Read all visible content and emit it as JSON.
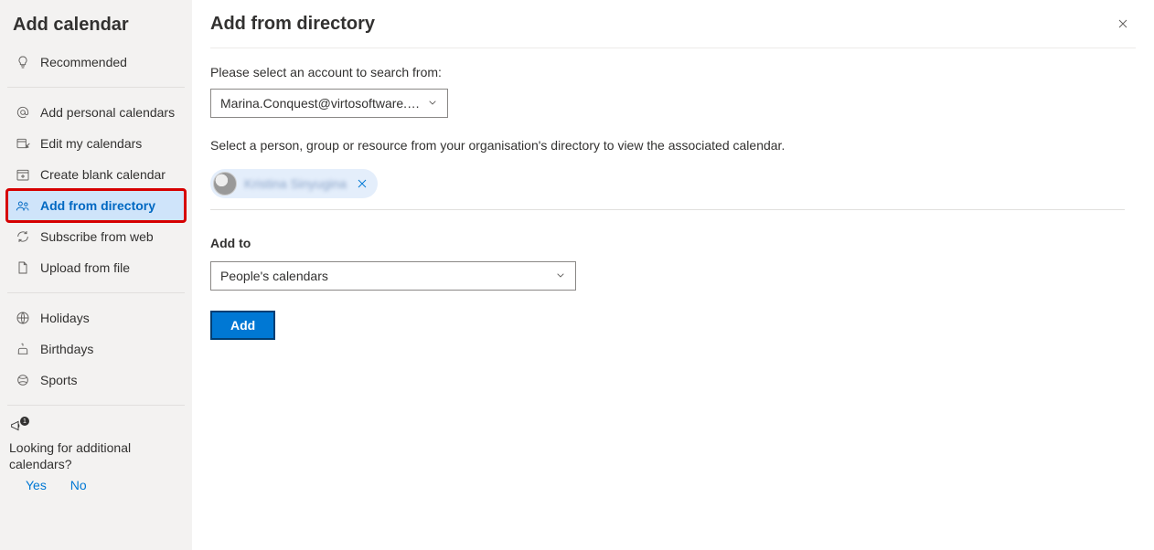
{
  "sidebar": {
    "title": "Add calendar",
    "items": [
      {
        "label": "Recommended",
        "icon": "lightbulb"
      },
      {
        "label": "Add personal calendars",
        "icon": "at"
      },
      {
        "label": "Edit my calendars",
        "icon": "edit-cal"
      },
      {
        "label": "Create blank calendar",
        "icon": "blank-cal"
      },
      {
        "label": "Add from directory",
        "icon": "people"
      },
      {
        "label": "Subscribe from web",
        "icon": "sync"
      },
      {
        "label": "Upload from file",
        "icon": "file"
      },
      {
        "label": "Holidays",
        "icon": "globe"
      },
      {
        "label": "Birthdays",
        "icon": "cake"
      },
      {
        "label": "Sports",
        "icon": "sports"
      }
    ],
    "feedback": {
      "question": "Looking for additional calendars?",
      "yes": "Yes",
      "no": "No"
    }
  },
  "main": {
    "title": "Add from directory",
    "account_label": "Please select an account to search from:",
    "account_value": "Marina.Conquest@virtosoftware.c…",
    "directory_desc": "Select a person, group or resource from your organisation's directory to view the associated calendar.",
    "selected_person": "Kristina Sinyugina",
    "add_to_label": "Add to",
    "add_to_value": "People's calendars",
    "add_button": "Add"
  }
}
